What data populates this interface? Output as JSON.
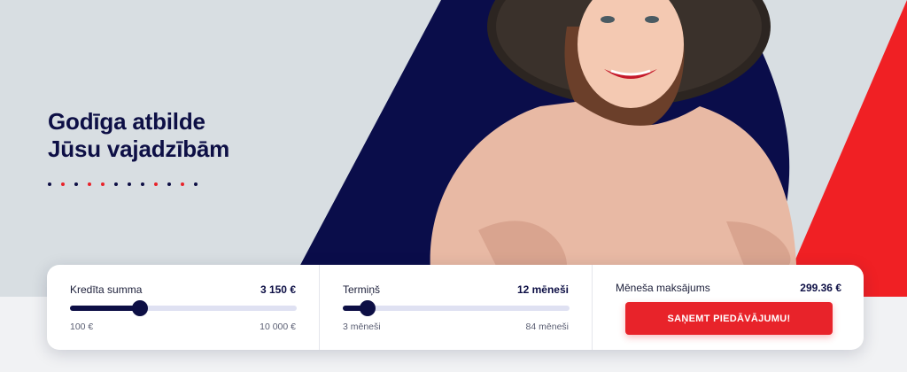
{
  "hero": {
    "headline_line1": "Godīga atbilde",
    "headline_line2": "Jūsu vajadzībām",
    "dot_colors": [
      "#0d0f45",
      "#e8232a",
      "#0d0f45",
      "#e8232a",
      "#e8232a",
      "#0d0f45",
      "#0d0f45",
      "#0d0f45",
      "#e8232a",
      "#0d0f45",
      "#e8232a",
      "#0d0f45"
    ]
  },
  "calculator": {
    "amount": {
      "label": "Kredīta summa",
      "value": "3 150 €",
      "min_label": "100  €",
      "max_label": "10 000  €",
      "min": 100,
      "max": 10000,
      "current": 3150
    },
    "term": {
      "label": "Termiņš",
      "value": "12 mēneši",
      "min_label": "3  mēneši",
      "max_label": "84  mēneši",
      "min": 3,
      "max": 84,
      "current": 12
    },
    "payment": {
      "label": "Mēneša maksājums",
      "value": "299.36 €",
      "button_label": "SAŅEMT PIEDĀVĀJUMU!"
    }
  },
  "colors": {
    "navy": "#0d0f45",
    "red": "#e8232a",
    "background": "#d8dee2"
  }
}
